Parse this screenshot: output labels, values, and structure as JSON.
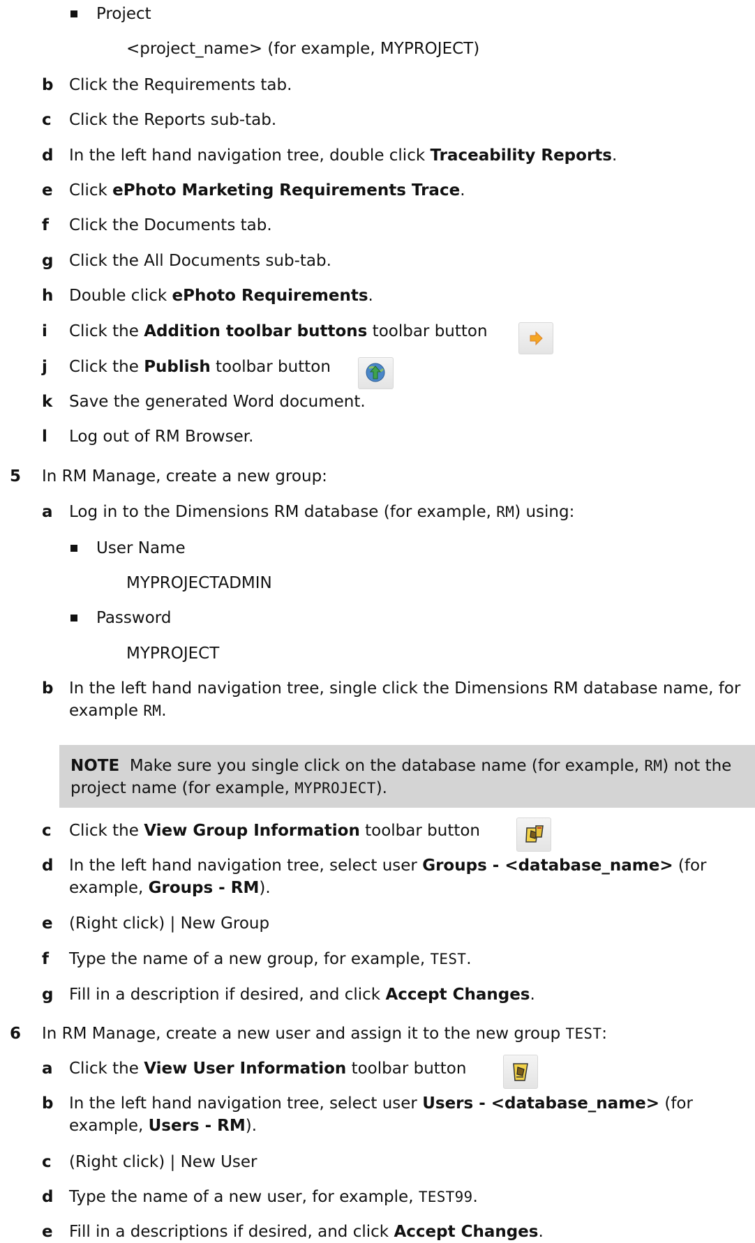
{
  "steps": {
    "bullet_project": "Project",
    "project_example": "<project_name> (for example, MYPROJECT)",
    "b_label": "b",
    "b_text": "Click the Requirements tab.",
    "c_label": "c",
    "c_text": "Click the Reports sub-tab.",
    "d_label": "d",
    "d_pre": "In the left hand navigation tree, double click ",
    "d_bold": "Traceability Reports",
    "d_post": ".",
    "e_label": "e",
    "e_pre": "Click ",
    "e_bold": "ePhoto Marketing Requirements Trace",
    "e_post": ".",
    "f_label": "f",
    "f_text": "Click the Documents tab.",
    "g_label": "g",
    "g_text": "Click the All Documents sub-tab.",
    "h_label": "h",
    "h_pre": "Double click ",
    "h_bold": "ePhoto Requirements",
    "h_post": ".",
    "i_label": "i",
    "i_pre": "Click the ",
    "i_bold": "Addition toolbar buttons",
    "i_post": " toolbar button",
    "j_label": "j",
    "j_pre": "Click the ",
    "j_bold": "Publish",
    "j_post": " toolbar button",
    "k_label": "k",
    "k_text": "Save the generated Word document.",
    "l_label": "l",
    "l_text": "Log out of RM Browser."
  },
  "step5": {
    "num": "5",
    "text": "In RM Manage, create a new group:",
    "a_label": "a",
    "a_pre": "Log in to the Dimensions RM database (for example, ",
    "a_code": "RM",
    "a_post": ") using:",
    "user_name_label": "User Name",
    "user_name_value": "MYPROJECTADMIN",
    "password_label": "Password",
    "password_value": "MYPROJECT",
    "b_label": "b",
    "b_pre": "In the left hand navigation tree, single click the Dimensions RM database name, for example ",
    "b_code": "RM",
    "b_post": ".",
    "note_label": "NOTE",
    "note_pre": "  Make sure you single click on the database name (for example, ",
    "note_code1": "RM",
    "note_mid": ") not the project name (for example, ",
    "note_code2": "MYPROJECT",
    "note_post": ").",
    "c_label": "c",
    "c_pre": "Click the ",
    "c_bold": "View Group Information",
    "c_post": " toolbar button",
    "d_label": "d",
    "d_pre": "In the left hand navigation tree, select user ",
    "d_bold1": "Groups - <database_name>",
    "d_mid": " (for example, ",
    "d_bold2": "Groups - RM",
    "d_post": ").",
    "e_label": "e",
    "e_text": "(Right click) | New Group",
    "f_label": "f",
    "f_pre": "Type the name of a new group, for example, ",
    "f_code": "TEST",
    "f_post": ".",
    "g_label": "g",
    "g_pre": "Fill in a description if desired, and click ",
    "g_bold": "Accept Changes",
    "g_post": "."
  },
  "step6": {
    "num": "6",
    "pre": "In RM Manage, create a new user and assign it to the new group ",
    "code": "TEST",
    "post": ":",
    "a_label": "a",
    "a_pre": "Click the ",
    "a_bold": "View User Information",
    "a_post": " toolbar button",
    "b_label": "b",
    "b_pre": "In the left hand navigation tree, select user ",
    "b_bold1": "Users - <database_name>",
    "b_mid": " (for example, ",
    "b_bold2": "Users - RM",
    "b_post": ").",
    "c_label": "c",
    "c_text": "(Right click) | New User",
    "d_label": "d",
    "d_pre": "Type the name of a new user, for example, ",
    "d_code": "TEST99",
    "d_post": ".",
    "e_label": "e",
    "e_pre": "Fill in a descriptions if desired, and click ",
    "e_bold": "Accept Changes",
    "e_post": "."
  },
  "icons": {
    "addition": "arrow-right-icon",
    "publish": "globe-upload-icon",
    "view_group": "group-info-icon",
    "view_user": "user-info-icon"
  }
}
